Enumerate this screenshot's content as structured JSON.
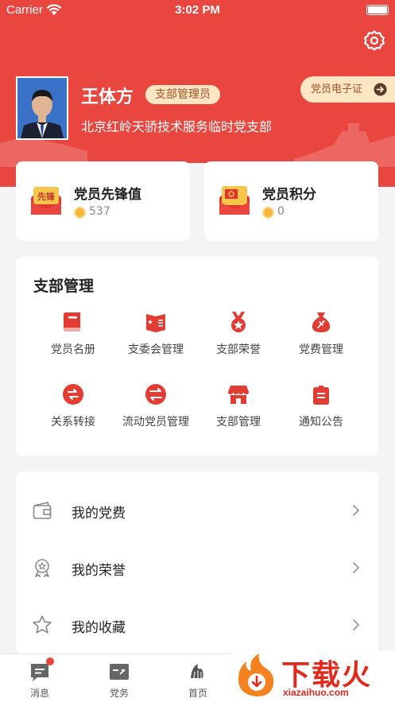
{
  "status_bar": {
    "carrier": "Carrier",
    "time": "3:02 PM"
  },
  "profile": {
    "name": "王体方",
    "role": "支部管理员",
    "branch": "北京红岭天骄技术服务临时党支部",
    "ecard_label": "党员电子证"
  },
  "scores": [
    {
      "icon": "vanguard-envelope-icon",
      "title": "党员先锋值",
      "value": "537",
      "badge": "先锋"
    },
    {
      "icon": "points-envelope-icon",
      "title": "党员积分",
      "value": "0"
    }
  ],
  "management": {
    "title": "支部管理",
    "items": [
      {
        "icon": "roster-book-icon",
        "label": "党员名册"
      },
      {
        "icon": "committee-flag-icon",
        "label": "支委会管理"
      },
      {
        "icon": "honor-medal-icon",
        "label": "支部荣誉"
      },
      {
        "icon": "dues-bag-icon",
        "label": "党费管理"
      },
      {
        "icon": "transfer-icon",
        "label": "关系转接"
      },
      {
        "icon": "mobile-member-icon",
        "label": "流动党员管理"
      },
      {
        "icon": "branch-store-icon",
        "label": "支部管理"
      },
      {
        "icon": "notice-board-icon",
        "label": "通知公告"
      }
    ]
  },
  "menu_list": [
    {
      "icon": "wallet-icon",
      "label": "我的党费"
    },
    {
      "icon": "award-icon",
      "label": "我的荣誉"
    },
    {
      "icon": "star-icon",
      "label": "我的收藏"
    }
  ],
  "tabbar": [
    {
      "icon": "message-icon",
      "label": "消息"
    },
    {
      "icon": "party-affairs-icon",
      "label": "党务"
    },
    {
      "icon": "home-icon",
      "label": "首页"
    }
  ],
  "watermark": {
    "text": "下载火",
    "domain": "xiazaihuo.com"
  },
  "colors": {
    "primary": "#e8463e",
    "badge_bg": "#fbe6c3",
    "badge_text": "#a3522a",
    "coin": "#f6b73c"
  }
}
